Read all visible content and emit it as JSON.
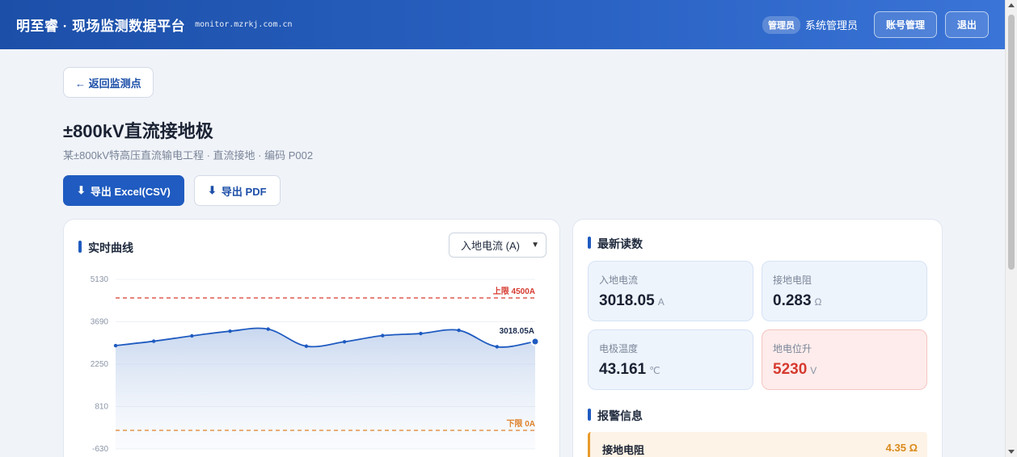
{
  "header": {
    "title": "明至睿 · 现场监测数据平台",
    "domain": "monitor.mzrkj.com.cn",
    "role_badge": "管理员",
    "username": "系统管理员",
    "account_button": "账号管理",
    "logout_button": "退出"
  },
  "page": {
    "back_label": "← 返回监测点",
    "title": "±800kV直流接地极",
    "subtitle": "某±800kV特高压直流输电工程 · 直流接地 · 编码 P002",
    "export_excel": "导出 Excel(CSV)",
    "export_pdf": "导出 PDF",
    "export_icon": "download-arrow-icon"
  },
  "chart_section": {
    "title": "实时曲线",
    "select_value": "入地电流 (A)"
  },
  "chart_data": {
    "type": "area",
    "y_ticks": [
      "5130",
      "3690",
      "2250",
      "810",
      "-630"
    ],
    "ylim": [
      -630,
      5130
    ],
    "values": [
      2880,
      3030,
      3210,
      3370,
      3440,
      2860,
      3010,
      3220,
      3290,
      3400,
      2840,
      3018.05
    ],
    "last_label": "3018.05A",
    "upper_limit": {
      "value": 4500,
      "label": "上限 4500A",
      "color": "#d63a2f"
    },
    "lower_limit": {
      "value": 0,
      "label": "下限 0A",
      "color": "#e0822a"
    },
    "line_color": "#1f5bc0",
    "grid": true
  },
  "readings": {
    "title": "最新读数",
    "tiles": [
      {
        "label": "入地电流",
        "value": "3018.05",
        "unit": "A"
      },
      {
        "label": "接地电阻",
        "value": "0.283",
        "unit": "Ω"
      },
      {
        "label": "电极温度",
        "value": "43.161",
        "unit": "℃"
      },
      {
        "label": "地电位升",
        "value": "5230",
        "unit": "V",
        "alert": true
      }
    ]
  },
  "alarms": {
    "title": "报警信息",
    "items": [
      {
        "name": "接地电阻",
        "value": "4.35 Ω"
      }
    ]
  }
}
